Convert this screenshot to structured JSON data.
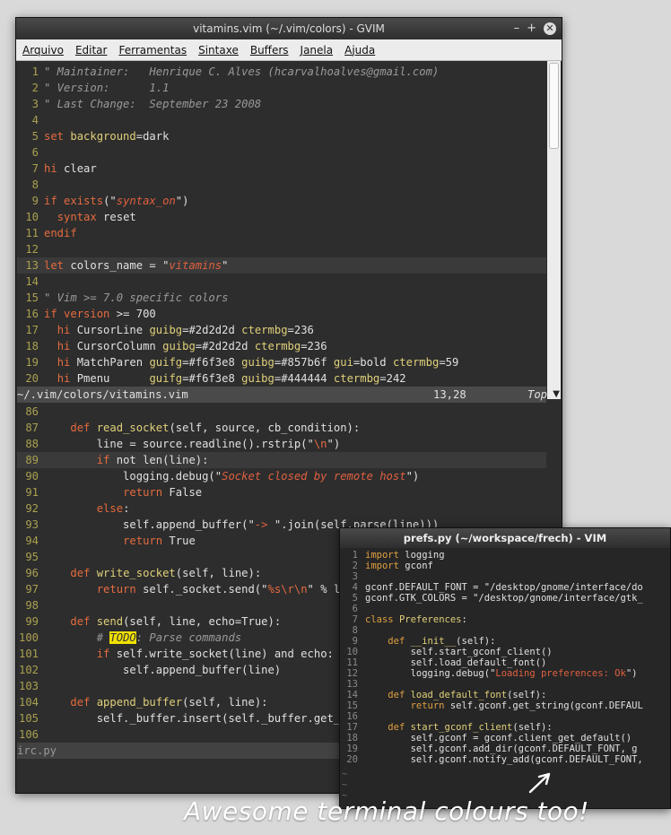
{
  "gvim": {
    "title": "vitamins.vim (~/.vim/colors) - GVIM",
    "menu": [
      "Arquivo",
      "Editar",
      "Ferramentas",
      "Sintaxe",
      "Buffers",
      "Janela",
      "Ajuda"
    ],
    "top_pane": {
      "lines": [
        {
          "n": "1",
          "t": "\" Maintainer:   Henrique C. Alves (hcarvalhoalves@gmail.com)"
        },
        {
          "n": "2",
          "t": "\" Version:      1.1"
        },
        {
          "n": "3",
          "t": "\" Last Change:  September 23 2008"
        },
        {
          "n": "4",
          "t": ""
        },
        {
          "n": "5",
          "t": "set background=dark"
        },
        {
          "n": "6",
          "t": ""
        },
        {
          "n": "7",
          "t": "hi clear"
        },
        {
          "n": "8",
          "t": ""
        },
        {
          "n": "9",
          "t": "if exists(\"syntax_on\")"
        },
        {
          "n": "10",
          "t": "  syntax reset"
        },
        {
          "n": "11",
          "t": "endif"
        },
        {
          "n": "12",
          "t": ""
        },
        {
          "n": "13",
          "t": "let colors_name = \"vitamins\""
        },
        {
          "n": "14",
          "t": ""
        },
        {
          "n": "15",
          "t": "\" Vim >= 7.0 specific colors"
        },
        {
          "n": "16",
          "t": "if version >= 700"
        },
        {
          "n": "17",
          "t": "  hi CursorLine guibg=#2d2d2d ctermbg=236"
        },
        {
          "n": "18",
          "t": "  hi CursorColumn guibg=#2d2d2d ctermbg=236"
        },
        {
          "n": "19",
          "t": "  hi MatchParen guifg=#f6f3e8 guibg=#857b6f gui=bold ctermbg=59"
        },
        {
          "n": "20",
          "t": "  hi Pmenu      guifg=#f6f3e8 guibg=#444444 ctermbg=242"
        }
      ],
      "status_file": "~/.vim/colors/vitamins.vim",
      "status_pos": "13,28",
      "status_top": "Top"
    },
    "bottom_pane": {
      "lines": [
        {
          "n": "86",
          "t": ""
        },
        {
          "n": "87",
          "t": "    def read_socket(self, source, cb_condition):"
        },
        {
          "n": "88",
          "t": "        line = source.readline().rstrip(\"\\n\")"
        },
        {
          "n": "89",
          "t": "        if not len(line):"
        },
        {
          "n": "90",
          "t": "            logging.debug(\"Socket closed by remote host\")"
        },
        {
          "n": "91",
          "t": "            return False"
        },
        {
          "n": "92",
          "t": "        else:"
        },
        {
          "n": "93",
          "t": "            self.append_buffer(\"-> \".join(self.parse(line)))"
        },
        {
          "n": "94",
          "t": "            return True"
        },
        {
          "n": "95",
          "t": ""
        },
        {
          "n": "96",
          "t": "    def write_socket(self, line):"
        },
        {
          "n": "97",
          "t": "        return self._socket.send(\"%s\\r\\n\" % line)"
        },
        {
          "n": "98",
          "t": ""
        },
        {
          "n": "99",
          "t": "    def send(self, line, echo=True):"
        },
        {
          "n": "100",
          "t": "        # TODO: Parse commands"
        },
        {
          "n": "101",
          "t": "        if self.write_socket(line) and echo:"
        },
        {
          "n": "102",
          "t": "            self.append_buffer(line)"
        },
        {
          "n": "103",
          "t": ""
        },
        {
          "n": "104",
          "t": "    def append_buffer(self, line):"
        },
        {
          "n": "105",
          "t": "        self._buffer.insert(self._buffer.get_en"
        },
        {
          "n": "106",
          "t": ""
        }
      ],
      "status_file": "irc.py"
    }
  },
  "vim": {
    "title": "prefs.py (~/workspace/frech) - VIM",
    "lines": [
      {
        "n": "1",
        "t": "import logging"
      },
      {
        "n": "2",
        "t": "import gconf"
      },
      {
        "n": "3",
        "t": ""
      },
      {
        "n": "4",
        "t": "gconf.DEFAULT_FONT = \"/desktop/gnome/interface/do"
      },
      {
        "n": "5",
        "t": "gconf.GTK_COLORS = \"/desktop/gnome/interface/gtk_"
      },
      {
        "n": "6",
        "t": ""
      },
      {
        "n": "7",
        "t": "class Preferences:"
      },
      {
        "n": "8",
        "t": ""
      },
      {
        "n": "9",
        "t": "    def __init__(self):"
      },
      {
        "n": "10",
        "t": "        self.start_gconf_client()"
      },
      {
        "n": "11",
        "t": "        self.load_default_font()"
      },
      {
        "n": "12",
        "t": "        logging.debug(\"Loading preferences: Ok\")"
      },
      {
        "n": "13",
        "t": ""
      },
      {
        "n": "14",
        "t": "    def load_default_font(self):"
      },
      {
        "n": "15",
        "t": "        return self.gconf.get_string(gconf.DEFAUL"
      },
      {
        "n": "16",
        "t": ""
      },
      {
        "n": "17",
        "t": "    def start_gconf_client(self):"
      },
      {
        "n": "18",
        "t": "        self.gconf = gconf.client_get_default()"
      },
      {
        "n": "19",
        "t": "        self.gconf.add_dir(gconf.DEFAULT_FONT, g"
      },
      {
        "n": "20",
        "t": "        self.gconf.notify_add(gconf.DEFAULT_FONT,"
      }
    ],
    "tildes": [
      "~",
      "~",
      "~"
    ]
  },
  "caption": "Awesome terminal colours too!",
  "colors": {
    "keyword": "#e56b3f",
    "string": "#e06040",
    "comment": "#9a9a9a",
    "linenr": "#a9a04f",
    "todo": "#f0e000"
  }
}
